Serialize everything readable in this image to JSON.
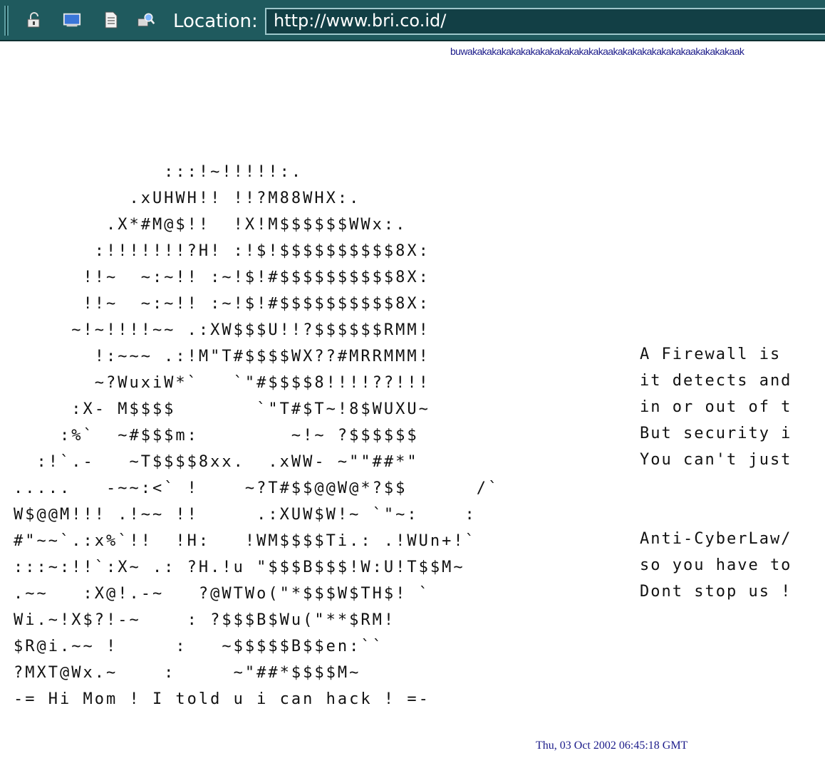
{
  "toolbar": {
    "icons": [
      "lock-icon",
      "screen-icon",
      "document-icon",
      "search-icon"
    ],
    "location_label": "Location:",
    "location_value": "http://www.bri.co.id/"
  },
  "page": {
    "banner": "buwakakakakakakakakakakakakakakaakakakakakakakakaakakakakaak",
    "ascii_art": [
      "             :::!~!!!!!:.",
      "          .xUHWH!! !!?M88WHX:.",
      "        .X*#M@$!!  !X!M$$$$$$WWx:.",
      "       :!!!!!!!?H! :!$!$$$$$$$$$$8X:",
      "      !!~  ~:~!! :~!$!#$$$$$$$$$$8X:",
      "      !!~  ~:~!! :~!$!#$$$$$$$$$$8X:",
      "     ~!~!!!!~~ .:XW$$$U!!?$$$$$$RMM!",
      "       !:~~~ .:!M\"T#$$$$WX??#MRRMMM!",
      "       ~?WuxiW*`   `\"#$$$$8!!!!??!!!",
      "     :X- M$$$$       `\"T#$T~!8$WUXU~",
      "    :%`  ~#$$$m:        ~!~ ?$$$$$$",
      "  :!`.-   ~T$$$$8xx.  .xWW- ~\"\"##*\"",
      ".....   -~~:<` !    ~?T#$$@@W@*?$$      /`",
      "W$@@M!!! .!~~ !!     .:XUW$W!~ `\"~:    :",
      "#\"~~`.:x%`!!  !H:   !WM$$$$Ti.: .!WUn+!`",
      ":::~:!!`:X~ .: ?H.!u \"$$$B$$$!W:U!T$$M~",
      ".~~   :X@!.-~   ?@WTWo(\"*$$$W$TH$! `",
      "Wi.~!X$?!-~    : ?$$$B$Wu(\"**$RM!",
      "$R@i.~~ !     :   ~$$$$$B$$en:``",
      "?MXT@Wx.~    :     ~\"##*$$$$M~",
      "-= Hi Mom ! I told u i can hack ! =-"
    ],
    "message_lines": [
      "A Firewall is",
      "it detects and",
      "in or out of t",
      "But security i",
      "You can't just",
      "",
      "",
      "Anti-CyberLaw/",
      "so you have to",
      "Dont stop us !"
    ],
    "timestamp": "Thu, 03 Oct 2002 06:45:18 GMT"
  }
}
